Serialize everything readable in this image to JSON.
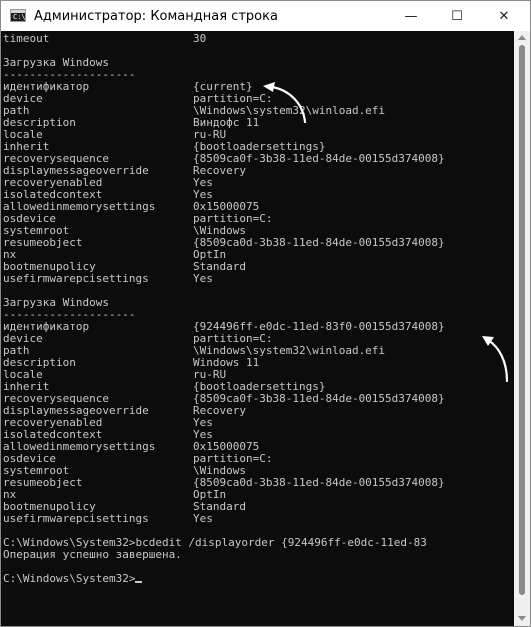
{
  "window": {
    "title": "Администратор: Командная строка",
    "app_icon_text": "C:\\",
    "controls": {
      "minimize": "—",
      "maximize": "☐",
      "close": "✕"
    }
  },
  "console": {
    "colors": {
      "background": "#0c0c0c",
      "text": "#c8c8c8",
      "annotation_arrow": "#ffffff"
    },
    "lines": [
      {
        "k": "timeout",
        "v": "30"
      },
      {
        "t": ""
      },
      {
        "t": "Загрузка Windows"
      },
      {
        "t": "--------------------"
      },
      {
        "k": "идентификатор",
        "v": "{current}"
      },
      {
        "k": "device",
        "v": "partition=C:"
      },
      {
        "k": "path",
        "v": "\\Windows\\system32\\winload.efi"
      },
      {
        "k": "description",
        "v": "Виндофс 11"
      },
      {
        "k": "locale",
        "v": "ru-RU"
      },
      {
        "k": "inherit",
        "v": "{bootloadersettings}"
      },
      {
        "k": "recoverysequence",
        "v": "{8509ca0f-3b38-11ed-84de-00155d374008}"
      },
      {
        "k": "displaymessageoverride",
        "v": "Recovery"
      },
      {
        "k": "recoveryenabled",
        "v": "Yes"
      },
      {
        "k": "isolatedcontext",
        "v": "Yes"
      },
      {
        "k": "allowedinmemorysettings",
        "v": "0x15000075"
      },
      {
        "k": "osdevice",
        "v": "partition=C:"
      },
      {
        "k": "systemroot",
        "v": "\\Windows"
      },
      {
        "k": "resumeobject",
        "v": "{8509ca0d-3b38-11ed-84de-00155d374008}"
      },
      {
        "k": "nx",
        "v": "OptIn"
      },
      {
        "k": "bootmenupolicy",
        "v": "Standard"
      },
      {
        "k": "usefirmwarepcisettings",
        "v": "Yes"
      },
      {
        "t": ""
      },
      {
        "t": "Загрузка Windows"
      },
      {
        "t": "--------------------"
      },
      {
        "k": "идентификатор",
        "v": "{924496ff-e0dc-11ed-83f0-00155d374008}"
      },
      {
        "k": "device",
        "v": "partition=C:"
      },
      {
        "k": "path",
        "v": "\\Windows\\system32\\winload.efi"
      },
      {
        "k": "description",
        "v": "Windows 11"
      },
      {
        "k": "locale",
        "v": "ru-RU"
      },
      {
        "k": "inherit",
        "v": "{bootloadersettings}"
      },
      {
        "k": "recoverysequence",
        "v": "{8509ca0f-3b38-11ed-84de-00155d374008}"
      },
      {
        "k": "displaymessageoverride",
        "v": "Recovery"
      },
      {
        "k": "recoveryenabled",
        "v": "Yes"
      },
      {
        "k": "isolatedcontext",
        "v": "Yes"
      },
      {
        "k": "allowedinmemorysettings",
        "v": "0x15000075"
      },
      {
        "k": "osdevice",
        "v": "partition=C:"
      },
      {
        "k": "systemroot",
        "v": "\\Windows"
      },
      {
        "k": "resumeobject",
        "v": "{8509ca0d-3b38-11ed-84de-00155d374008}"
      },
      {
        "k": "nx",
        "v": "OptIn"
      },
      {
        "k": "bootmenupolicy",
        "v": "Standard"
      },
      {
        "k": "usefirmwarepcisettings",
        "v": "Yes"
      },
      {
        "t": ""
      },
      {
        "t": "C:\\Windows\\System32>bcdedit /displayorder {924496ff-e0dc-11ed-83"
      },
      {
        "t": "Операция успешно завершена."
      },
      {
        "t": ""
      },
      {
        "t": "C:\\Windows\\System32>",
        "cursor": true
      }
    ]
  }
}
